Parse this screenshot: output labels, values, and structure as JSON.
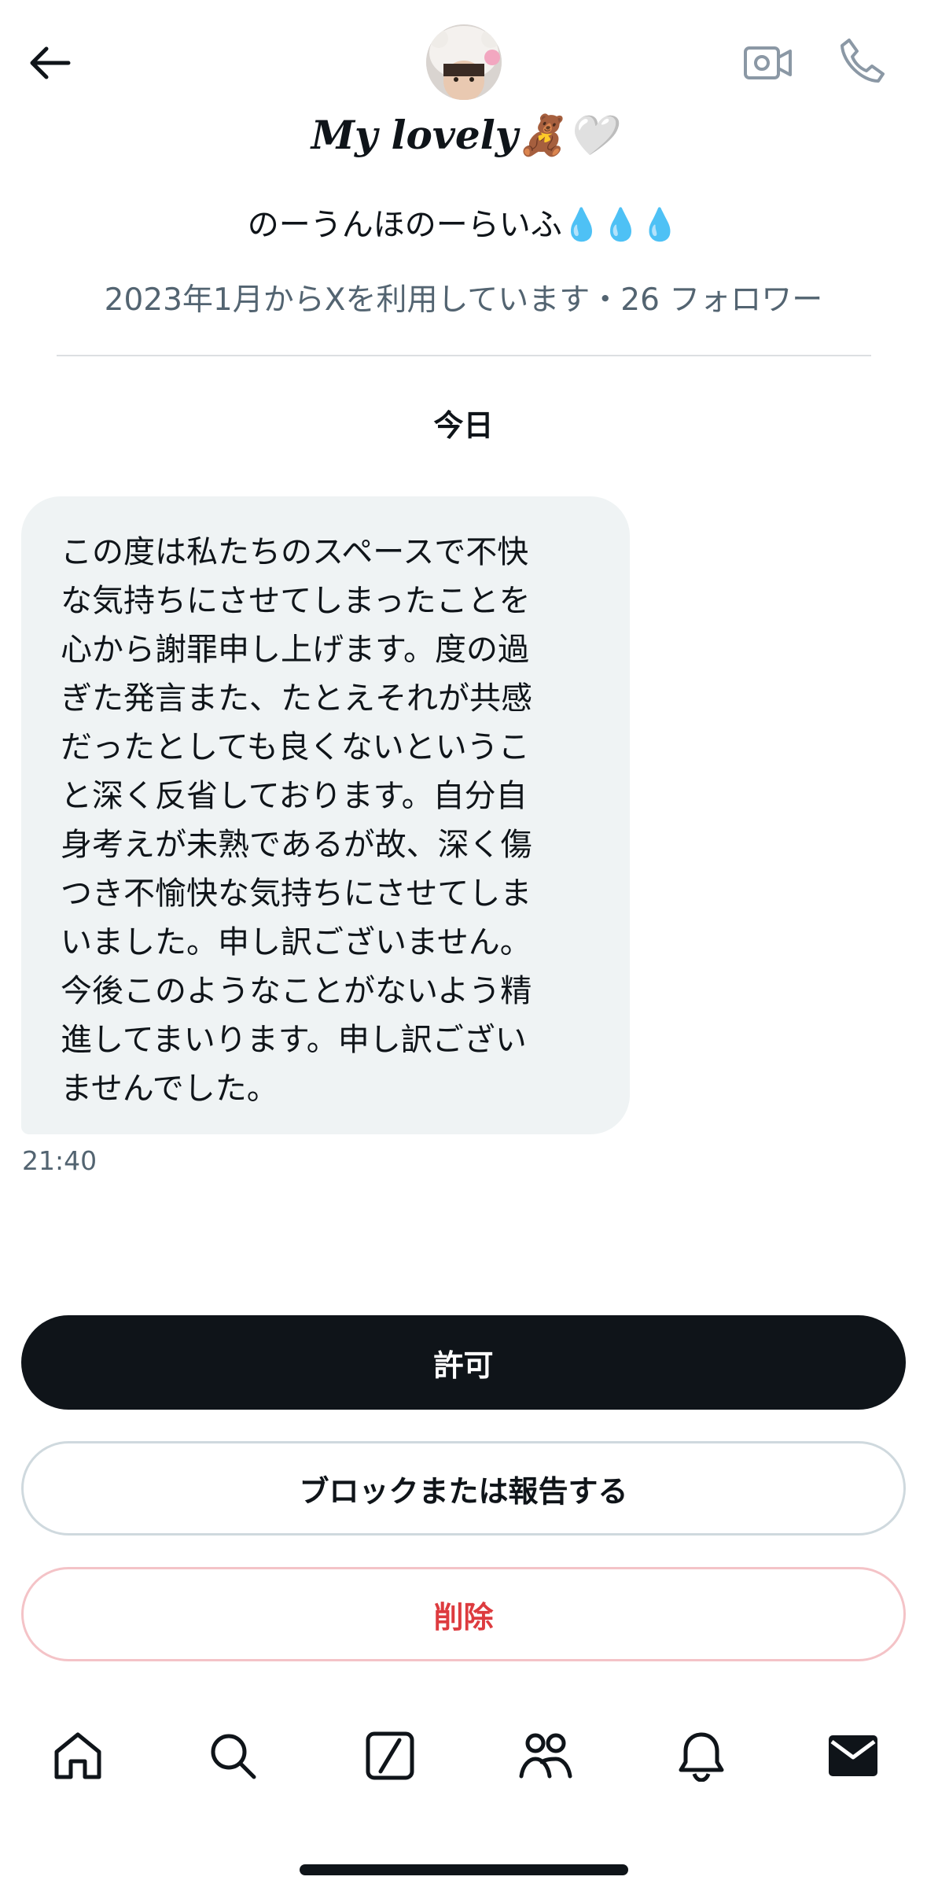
{
  "header": {
    "back_icon": "arrow-left-icon",
    "video_call_icon": "video-camera-icon",
    "voice_call_icon": "phone-icon",
    "avatar_alt": "profile avatar"
  },
  "profile": {
    "display_name": "My lovely🧸🤍",
    "bio": "のーうんほのーらいふ💧💧💧",
    "joined": "2023年1月からXを利用しています・26 フォロワー"
  },
  "conversation": {
    "date_separator": "今日",
    "messages": [
      {
        "text": "この度は私たちのスペースで不快\nな気持ちにさせてしまったことを\n心から謝罪申し上げます。度の過\nぎた発言また、たとえそれが共感\nだったとしても良くないというこ\nと深く反省しております。自分自\n身考えが未熟であるが故、深く傷\nつき不愉快な気持ちにさせてしま\nいました。申し訳ございません。\n今後このようなことがないよう精\n進してまいります。申し訳ござい\nませんでした。",
        "time": "21:40"
      }
    ]
  },
  "actions": {
    "allow_label": "許可",
    "block_label": "ブロックまたは報告する",
    "delete_label": "削除"
  },
  "tabbar": {
    "items": [
      {
        "icon": "home-icon"
      },
      {
        "icon": "search-icon"
      },
      {
        "icon": "grok-icon"
      },
      {
        "icon": "communities-icon"
      },
      {
        "icon": "bell-icon"
      },
      {
        "icon": "mail-icon",
        "active": true
      }
    ]
  },
  "colors": {
    "text": "#0f1419",
    "secondary": "#536471",
    "bubble": "#eff3f4",
    "danger": "#dd3b3f"
  }
}
